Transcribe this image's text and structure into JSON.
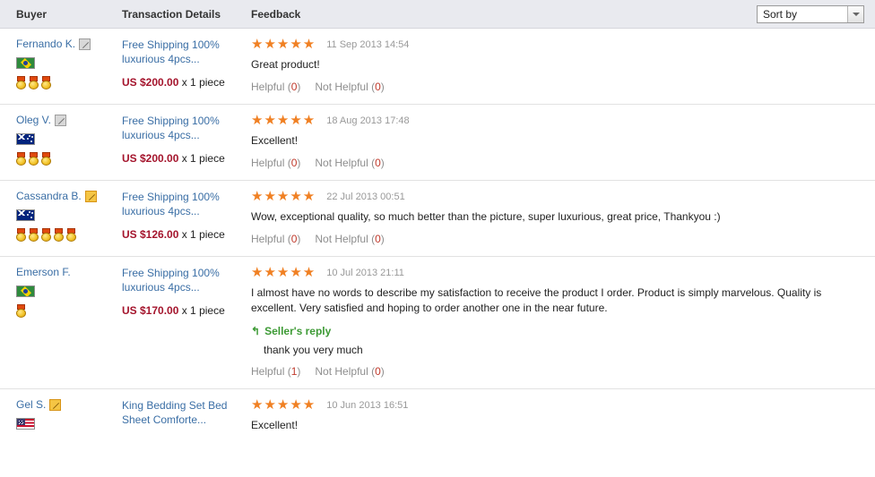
{
  "header": {
    "columns": [
      {
        "label": "Buyer"
      },
      {
        "label": "Transaction Details"
      },
      {
        "label": "Feedback"
      }
    ],
    "sort": {
      "value": "Sort by",
      "icon": "chevron-down-icon"
    }
  },
  "colors": {
    "header_bg": "#e9eaef",
    "link": "#3a6ea5",
    "price": "#a4142c",
    "star": "#f08023",
    "reply": "#3d9a35",
    "muted": "#999999",
    "count": "#c0392b"
  },
  "labels": {
    "helpful": "Helpful",
    "not_helpful": "Not Helpful",
    "sellers_reply": "Seller's reply",
    "quantity_prefix": "x"
  },
  "rows": [
    {
      "buyer": {
        "name": "Fernando K.",
        "badge": "gray",
        "flag": "br",
        "medals": 3
      },
      "transaction": {
        "item": "Free Shipping 100% luxurious 4pcs...",
        "price": "US $200.00",
        "quantity": "1",
        "unit": "piece"
      },
      "feedback": {
        "stars": 5,
        "date": "11 Sep 2013 14:54",
        "comment": "Great product!",
        "helpful_count": "0",
        "not_helpful_count": "0",
        "reply": null
      }
    },
    {
      "buyer": {
        "name": "Oleg V.",
        "badge": "gray",
        "flag": "au",
        "medals": 3
      },
      "transaction": {
        "item": "Free Shipping 100% luxurious 4pcs...",
        "price": "US $200.00",
        "quantity": "1",
        "unit": "piece"
      },
      "feedback": {
        "stars": 5,
        "date": "18 Aug 2013 17:48",
        "comment": "Excellent!",
        "helpful_count": "0",
        "not_helpful_count": "0",
        "reply": null
      }
    },
    {
      "buyer": {
        "name": "Cassandra B.",
        "badge": "gold",
        "flag": "au",
        "medals": 5
      },
      "transaction": {
        "item": "Free Shipping 100% luxurious 4pcs...",
        "price": "US $126.00",
        "quantity": "1",
        "unit": "piece"
      },
      "feedback": {
        "stars": 5,
        "date": "22 Jul 2013 00:51",
        "comment": "Wow, exceptional quality, so much better than the picture, super luxurious, great price, Thankyou :)",
        "helpful_count": "0",
        "not_helpful_count": "0",
        "reply": null
      }
    },
    {
      "buyer": {
        "name": "Emerson F.",
        "badge": "none",
        "flag": "br",
        "medals": 1
      },
      "transaction": {
        "item": "Free Shipping 100% luxurious 4pcs...",
        "price": "US $170.00",
        "quantity": "1",
        "unit": "piece"
      },
      "feedback": {
        "stars": 5,
        "date": "10 Jul 2013 21:11",
        "comment": "I almost have no words to describe my satisfaction to receive the product I order. Product is simply marvelous. Quality is excellent. Very satisfied and hoping to order another one in the near future.",
        "helpful_count": "1",
        "not_helpful_count": "0",
        "reply": {
          "title": "Seller's reply",
          "text": "thank you very much"
        }
      }
    },
    {
      "buyer": {
        "name": "Gel S.",
        "badge": "gold",
        "flag": "us",
        "medals": 0
      },
      "transaction": {
        "item": "King Bedding Set Bed Sheet Comforte...",
        "price": "",
        "quantity": "",
        "unit": ""
      },
      "feedback": {
        "stars": 5,
        "date": "10 Jun 2013 16:51",
        "comment": "Excellent!",
        "helpful_count": null,
        "not_helpful_count": null,
        "reply": null
      }
    }
  ]
}
